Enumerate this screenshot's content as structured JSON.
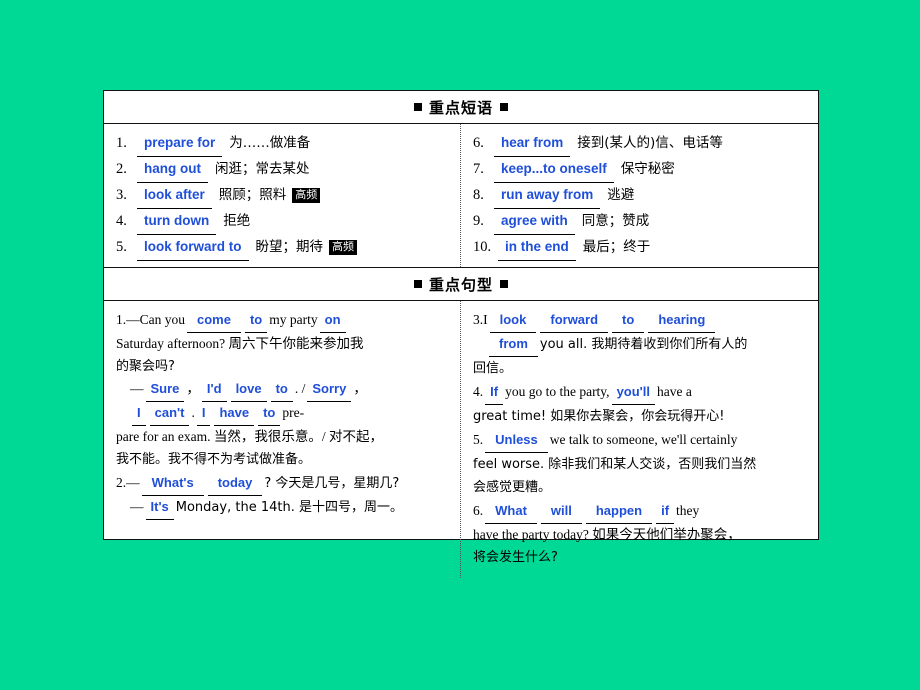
{
  "theme": {
    "background": "#00d995",
    "card_bg": "#ffffff",
    "blank_text_color": "#1f4fd8",
    "tag_bg": "#000000"
  },
  "sections": {
    "phrases": {
      "title": "重点短语",
      "left": [
        {
          "num": "1.",
          "blank": "prepare for",
          "meaning": "为……做准备",
          "tag": ""
        },
        {
          "num": "2.",
          "blank": "hang out",
          "meaning": "闲逛；常去某处",
          "tag": ""
        },
        {
          "num": "3.",
          "blank": "look after",
          "meaning": "照顾；照料",
          "tag": "高频"
        },
        {
          "num": "4.",
          "blank": "turn down",
          "meaning": "拒绝",
          "tag": ""
        },
        {
          "num": "5.",
          "blank": "look forward to",
          "meaning": "盼望；期待",
          "tag": "高频"
        }
      ],
      "right": [
        {
          "num": "6.",
          "blank": "hear from",
          "meaning": "接到(某人的)信、电话等",
          "tag": ""
        },
        {
          "num": "7.",
          "blank": "keep...to oneself",
          "meaning": "保守秘密",
          "tag": ""
        },
        {
          "num": "8.",
          "blank": "run away from",
          "meaning": "逃避",
          "tag": ""
        },
        {
          "num": "9.",
          "blank": "agree with",
          "meaning": "同意；赞成",
          "tag": ""
        },
        {
          "num": "10.",
          "blank": "in the end",
          "meaning": "最后；终于",
          "tag": ""
        }
      ]
    },
    "sentences": {
      "title": "重点句型",
      "items": [
        {
          "num": "1.",
          "lead": "—Can you",
          "b1": "come",
          "b2": "to",
          "t1": "my party",
          "b3": "on",
          "l2": "Saturday afternoon?  周六下午你能来参加我",
          "l3": "的聚会吗?",
          "l4_dash": "—",
          "b4": "Sure",
          "b5": "I'd",
          "b6": "love",
          "b7": "to",
          "b8": "Sorry",
          "b9": "I",
          "b10": "can't",
          "b11": "I",
          "b12": "have",
          "b13": "to",
          "tail1": "pre-",
          "l5": "pare for an exam. 当然，我很乐意。/ 对不起，",
          "l6": "我不能。我不得不为考试做准备。"
        },
        {
          "num": "2.",
          "lead": "—",
          "b1": "What's",
          "b2": "today",
          "t1": "?  今天是几号，星期几?",
          "l2_dash": "—",
          "b3": "It's",
          "t2": "Monday, the 14th. 是十四号，周一。"
        },
        {
          "num": "3.",
          "lead": "I",
          "b1": "look",
          "b2": "forward",
          "b3": "to",
          "b4": "hearing",
          "b5": "from",
          "t1": "you all. 我期待着收到你们所有人的",
          "l2": "回信。"
        },
        {
          "num": "4.",
          "b1": "If",
          "t1": "you go to the party,",
          "b2": "you'll",
          "t2": "have a",
          "l2": "great time!  如果你去聚会，你会玩得开心!"
        },
        {
          "num": "5.",
          "b1": "Unless",
          "t1": "we talk to someone, we'll certainly",
          "l2": "feel worse. 除非我们和某人交谈，否则我们当然",
          "l3": "会感觉更糟。"
        },
        {
          "num": "6.",
          "b1": "What",
          "b2": "will",
          "b3": "happen",
          "b4": "if",
          "t1": "they",
          "l2": "have the party today?  如果今天他们举办聚会，",
          "l3": "将会发生什么?"
        }
      ]
    }
  }
}
